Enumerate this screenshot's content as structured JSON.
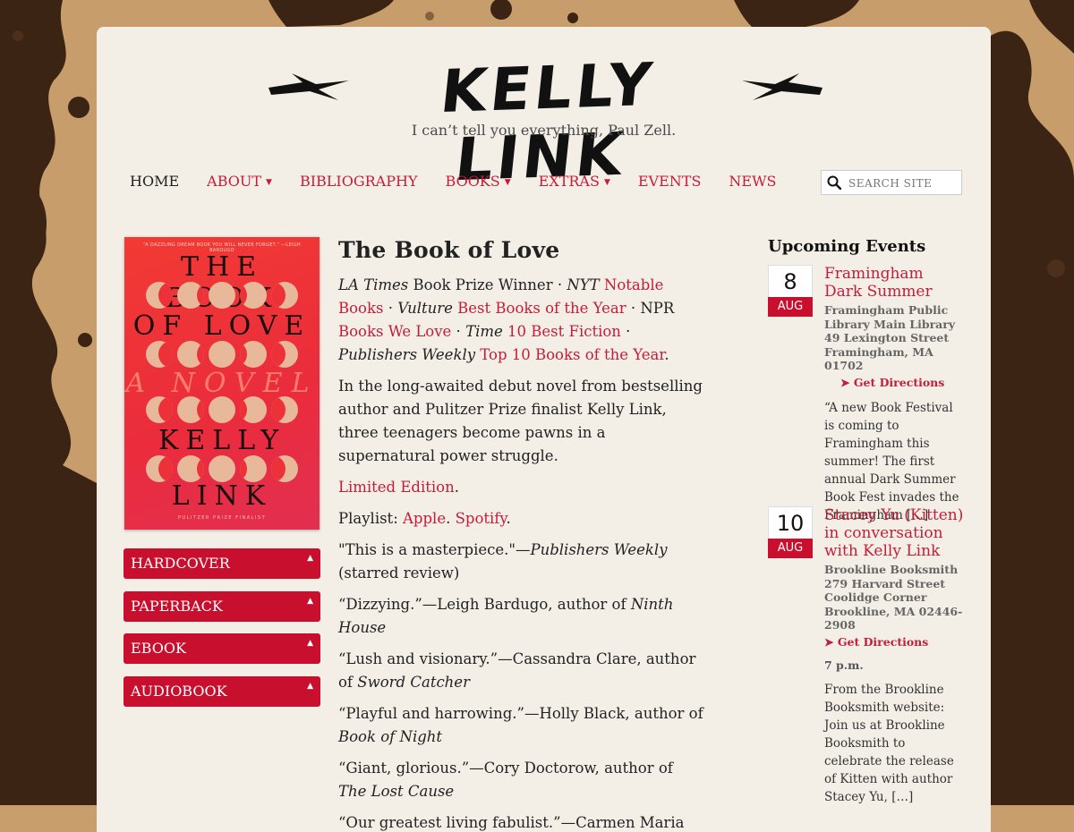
{
  "site": {
    "logo_text": "KELLY LINK",
    "tagline": "I can’t tell you everything, Paul Zell."
  },
  "nav": {
    "items": [
      {
        "label": "HOME",
        "active": true,
        "dropdown": false
      },
      {
        "label": "ABOUT",
        "active": false,
        "dropdown": true
      },
      {
        "label": "BIBLIOGRAPHY",
        "active": false,
        "dropdown": false
      },
      {
        "label": "BOOKS",
        "active": false,
        "dropdown": true
      },
      {
        "label": "EXTRAS",
        "active": false,
        "dropdown": true
      },
      {
        "label": "EVENTS",
        "active": false,
        "dropdown": false
      },
      {
        "label": "NEWS",
        "active": false,
        "dropdown": false
      }
    ],
    "search_placeholder": "SEARCH SITE"
  },
  "cover": {
    "blurb": "“A DAZZLING DREAM BOOK YOU WILL NEVER FORGET.” —LEIGH BARDUGO",
    "title_line1": "THE BOOK",
    "title_line2": "OF LOVE",
    "subtitle": "A NOVEL",
    "author_line1": "KELLY",
    "author_line2": "LINK",
    "footer": "PULITZER PRIZE FINALIST"
  },
  "formats": [
    "HARDCOVER",
    "PAPERBACK",
    "EBOOK",
    "AUDIOBOOK"
  ],
  "book": {
    "title": "The Book of Love",
    "awards": {
      "la_times": "LA Times",
      "prize_winner": " Book Prize Winner · ",
      "nyt": "NYT",
      "notable_books": "Notable Books",
      "sep1": " · ",
      "vulture": "Vulture",
      "best_books_year": "Best Books of the Year",
      "npr": " · NPR ",
      "books_we_love": "Books We Love",
      "sep2": " · ",
      "time": "Time",
      "ten_best_fiction": "10 Best Fiction",
      "sep3": " · ",
      "pw": "Publishers Weekly",
      "top10": "Top 10 Books of the Year",
      "period": "."
    },
    "description": "In the long-awaited debut novel from bestselling author and Pulitzer Prize finalist Kelly Link, three teenagers become pawns in a supernatural power struggle.",
    "limited_edition": "Limited Edition",
    "limited_period": ".",
    "playlist_label": "Playlist: ",
    "playlist_apple": "Apple",
    "playlist_dot": ". ",
    "playlist_spotify": "Spotify",
    "playlist_end": ".",
    "quotes": [
      {
        "quote": "\"This is a masterpiece.\"—",
        "source_italic": "Publishers Weekly",
        "suffix": " (starred review)"
      },
      {
        "quote": "“Dizzying.”—Leigh Bardugo, author of ",
        "source_italic": "Ninth House",
        "suffix": ""
      },
      {
        "quote": "“Lush and visionary.”—Cassandra Clare, author of ",
        "source_italic": "Sword Catcher",
        "suffix": ""
      },
      {
        "quote": "“Playful and harrowing.”—Holly Black, author of ",
        "source_italic": "Book of Night",
        "suffix": ""
      },
      {
        "quote": "“Giant, glorious.”—Cory Doctorow, author of ",
        "source_italic": "The Lost Cause",
        "suffix": ""
      },
      {
        "quote": "“Our greatest living fabulist.”—Carmen Maria",
        "source_italic": "",
        "suffix": ""
      }
    ]
  },
  "events": {
    "heading": "Upcoming Events",
    "items": [
      {
        "day": "8",
        "month": "AUG",
        "title": "Framingham Dark Summer",
        "location": "Framingham Public Library Main Library 49 Lexington Street Framingham, MA 01702",
        "directions": "Get Directions",
        "time": "",
        "description": "“A new Book Festival is coming to Framingham this summer! The first annual Dark Summer Book Fest invades the Framingham […]"
      },
      {
        "day": "10",
        "month": "AUG",
        "title": "Stacey Yu (Kitten) in conversation with Kelly Link",
        "location": "Brookline Booksmith 279 Harvard Street Coolidge Corner Brookline, MA 02446-2908",
        "directions": "Get Directions",
        "time": "7 p.m.",
        "description": "From the Brookline Booksmith website: Join us at Brookline Booksmith to celebrate the release of Kitten with author Stacey Yu, […]"
      }
    ]
  },
  "colors": {
    "accent": "#c41d3a",
    "button": "#c8102e",
    "page_bg": "#f3efe6",
    "outer_bg": "#c89e6c"
  }
}
